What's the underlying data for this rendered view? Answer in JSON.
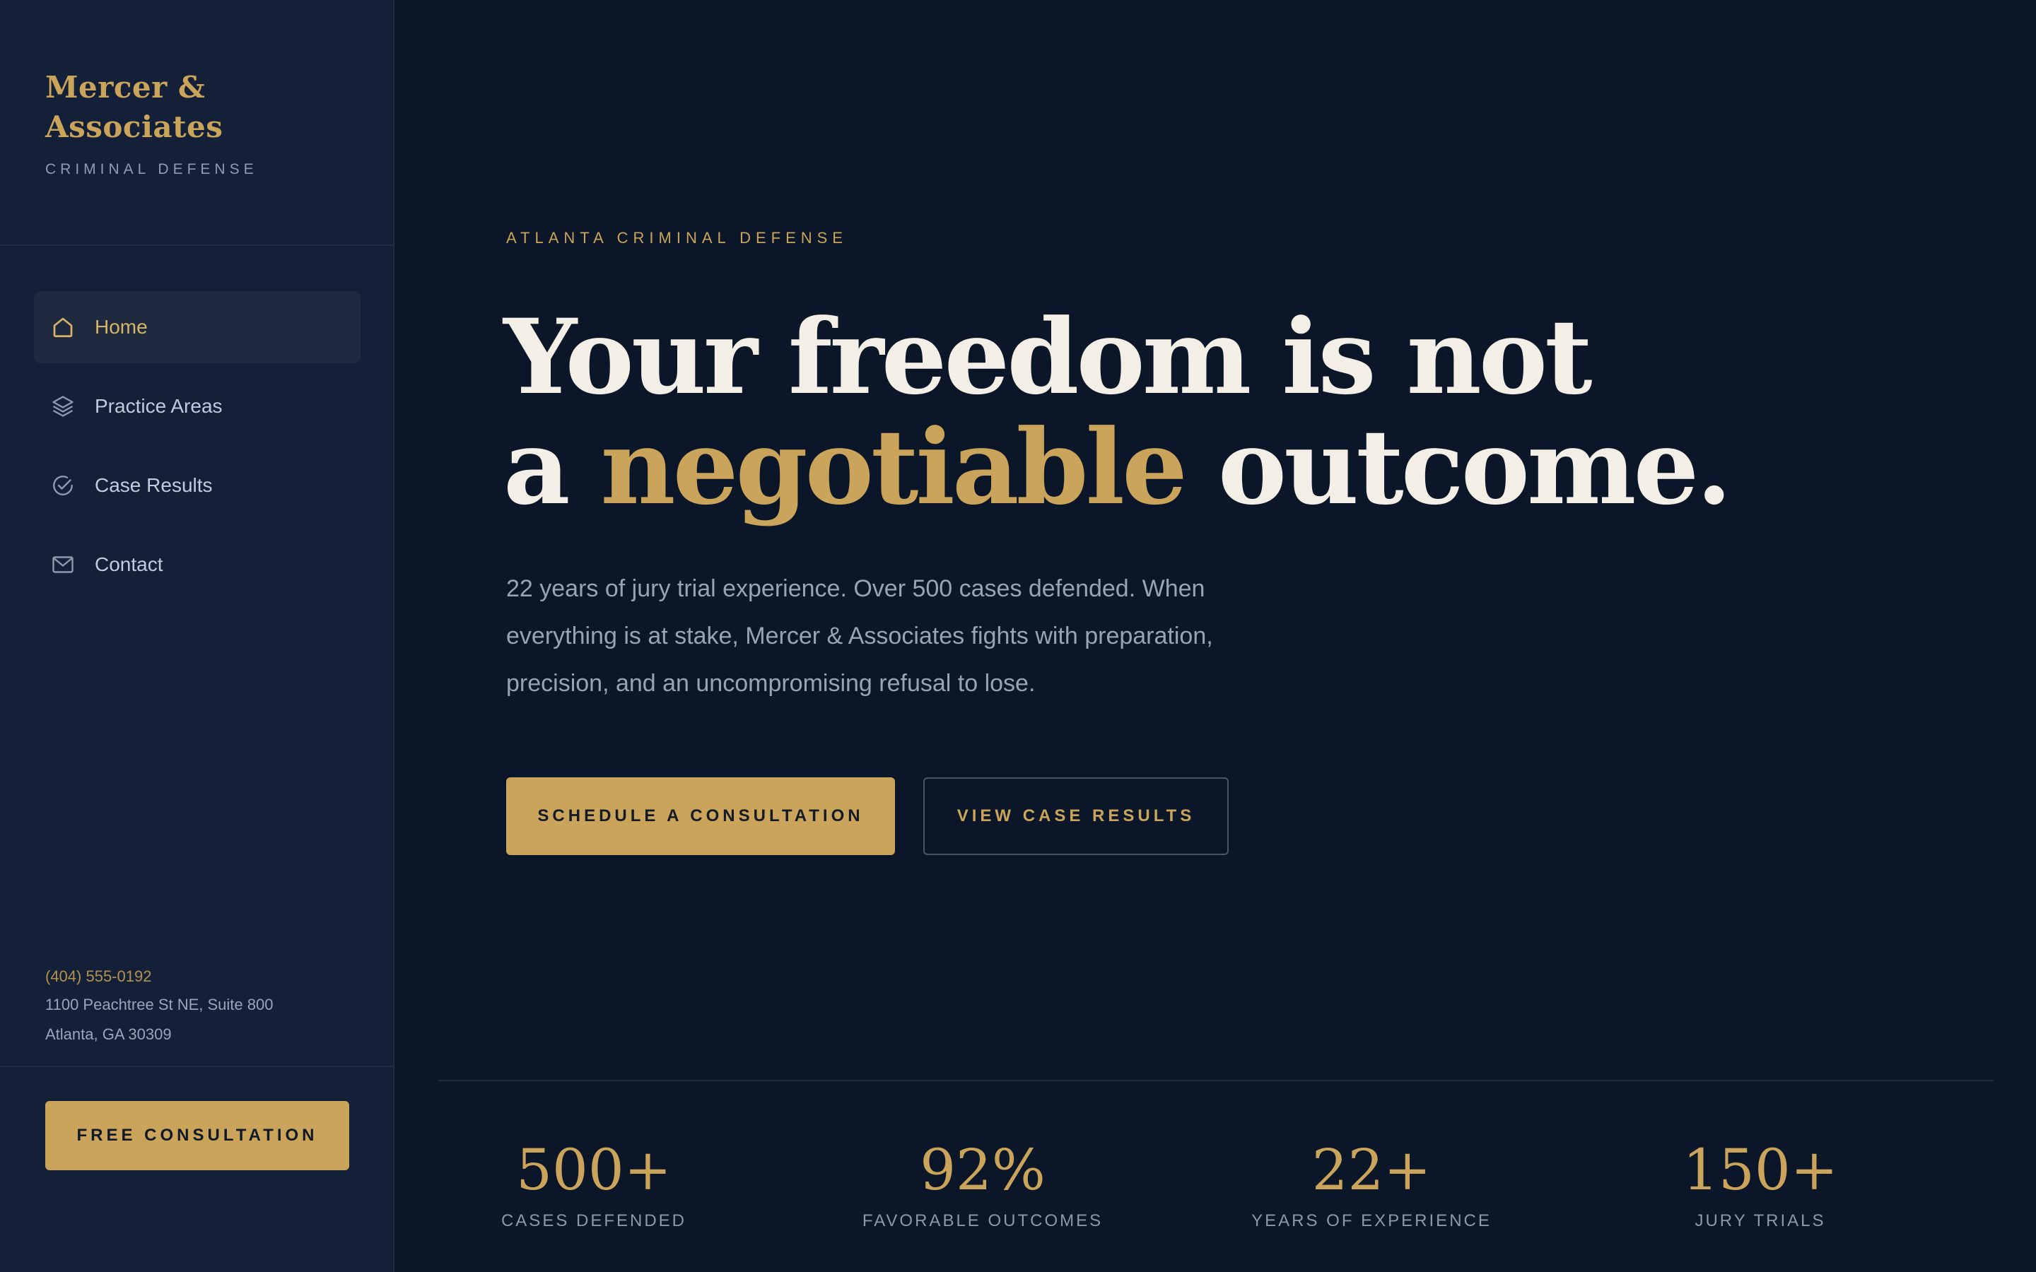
{
  "sidebar": {
    "brand_line1": "Mercer &",
    "brand_line2": "Associates",
    "tagline": "CRIMINAL DEFENSE",
    "nav": [
      {
        "label": "Home",
        "icon": "home-icon",
        "active": true
      },
      {
        "label": "Practice Areas",
        "icon": "layers-icon",
        "active": false
      },
      {
        "label": "Case Results",
        "icon": "check-circle-icon",
        "active": false
      },
      {
        "label": "Contact",
        "icon": "mail-icon",
        "active": false
      }
    ],
    "phone": "(404) 555-0192",
    "address_line1": "1100 Peachtree St NE, Suite 800",
    "address_line2": "Atlanta, GA 30309",
    "cta_label": "FREE CONSULTATION"
  },
  "hero": {
    "eyebrow": "ATLANTA CRIMINAL DEFENSE",
    "headline_line1": "Your freedom is not",
    "headline_a": "a",
    "headline_highlight": "negotiable",
    "headline_end": "outcome.",
    "lede": "22 years of jury trial experience. Over 500 cases defended. When everything is at stake, Mercer & Associates fights with preparation, precision, and an uncompromising refusal to lose.",
    "primary_cta": "SCHEDULE A CONSULTATION",
    "secondary_cta": "VIEW CASE RESULTS"
  },
  "stats": [
    {
      "value": "500+",
      "label": "CASES DEFENDED"
    },
    {
      "value": "92%",
      "label": "FAVORABLE OUTCOMES"
    },
    {
      "value": "22+",
      "label": "YEARS OF EXPERIENCE"
    },
    {
      "value": "150+",
      "label": "JURY TRIALS"
    }
  ],
  "colors": {
    "background": "#0b1628",
    "sidebar": "#142038",
    "accent_gold": "#c9a45a",
    "headline": "#f4efe6"
  }
}
